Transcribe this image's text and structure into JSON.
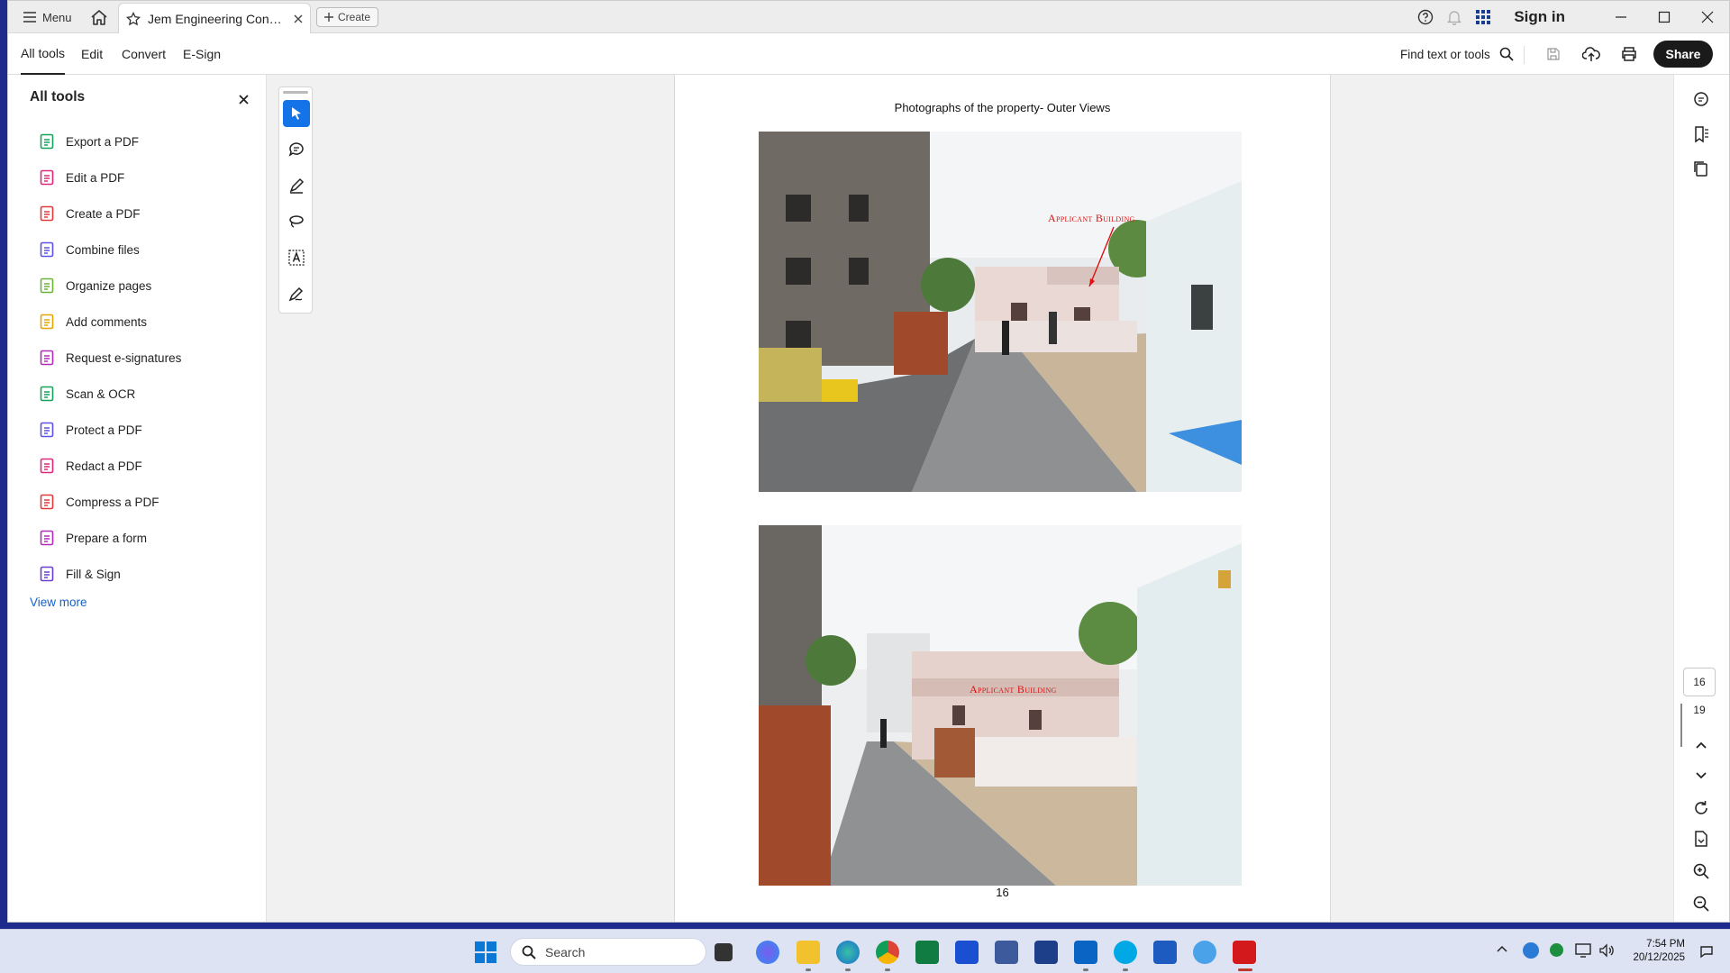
{
  "titlebar": {
    "menu_label": "Menu",
    "tab_title": "Jem Engineering Consult...",
    "create_label": "Create",
    "sign_in": "Sign in"
  },
  "menubar": {
    "tabs": [
      "All tools",
      "Edit",
      "Convert",
      "E-Sign"
    ],
    "find_label": "Find text or tools",
    "share_label": "Share"
  },
  "left_panel": {
    "title": "All tools",
    "tools": [
      {
        "label": "Export a PDF",
        "icon": "export-pdf-icon",
        "color": "#14a35a"
      },
      {
        "label": "Edit a PDF",
        "icon": "edit-pdf-icon",
        "color": "#e0297a"
      },
      {
        "label": "Create a PDF",
        "icon": "create-pdf-icon",
        "color": "#e23a3a"
      },
      {
        "label": "Combine files",
        "icon": "combine-files-icon",
        "color": "#5b52e6"
      },
      {
        "label": "Organize pages",
        "icon": "organize-pages-icon",
        "color": "#6cb43a"
      },
      {
        "label": "Add comments",
        "icon": "add-comments-icon",
        "color": "#e6a500"
      },
      {
        "label": "Request e-signatures",
        "icon": "request-esign-icon",
        "color": "#b32bbd"
      },
      {
        "label": "Scan & OCR",
        "icon": "scan-ocr-icon",
        "color": "#14a35a"
      },
      {
        "label": "Protect a PDF",
        "icon": "protect-pdf-icon",
        "color": "#5b52e6"
      },
      {
        "label": "Redact a PDF",
        "icon": "redact-pdf-icon",
        "color": "#e0297a"
      },
      {
        "label": "Compress a PDF",
        "icon": "compress-pdf-icon",
        "color": "#e23a3a"
      },
      {
        "label": "Prepare a form",
        "icon": "prepare-form-icon",
        "color": "#b32bbd"
      },
      {
        "label": "Fill & Sign",
        "icon": "fill-sign-icon",
        "color": "#6b3fd6"
      }
    ],
    "view_more": "View more"
  },
  "document": {
    "heading": "Photographs of the property- Outer Views",
    "photo_label_1": "Applicant Building",
    "photo_label_2": "Applicant Building",
    "page_number": "16"
  },
  "right_rail": {
    "current_page": "16",
    "total_pages": "19"
  },
  "taskbar": {
    "search_placeholder": "Search",
    "time": "7:54 PM",
    "date": "20/12/2025"
  },
  "colors": {
    "accent": "#1473e6",
    "share_bg": "#1a1a1a",
    "link": "#1762c7",
    "annotation": "#dd1111"
  }
}
